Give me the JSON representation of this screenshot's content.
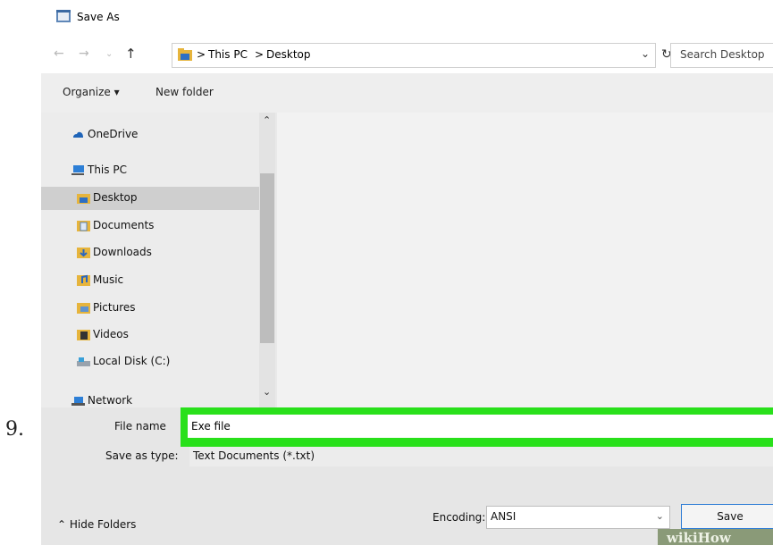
{
  "step_number": "9.",
  "window": {
    "title": "Save As"
  },
  "navigation": {
    "back_icon": "arrow-left-icon",
    "forward_icon": "arrow-right-icon",
    "recent_icon": "chevron-down-icon",
    "up_icon": "arrow-up-icon"
  },
  "address_bar": {
    "segments": [
      "This PC",
      "Desktop"
    ],
    "separator": ">"
  },
  "search": {
    "placeholder": "Search Desktop"
  },
  "toolbar": {
    "organize_label": "Organize ▾",
    "new_folder_label": "New folder"
  },
  "sidebar": {
    "items": [
      {
        "label": "OneDrive",
        "icon": "cloud-icon"
      },
      {
        "label": "This PC",
        "icon": "computer-icon"
      },
      {
        "label": "Desktop",
        "icon": "desktop-folder-icon",
        "selected": true
      },
      {
        "label": "Documents",
        "icon": "documents-icon"
      },
      {
        "label": "Downloads",
        "icon": "downloads-icon"
      },
      {
        "label": "Music",
        "icon": "music-icon"
      },
      {
        "label": "Pictures",
        "icon": "pictures-icon"
      },
      {
        "label": "Videos",
        "icon": "videos-icon"
      },
      {
        "label": "Local Disk (C:)",
        "icon": "disk-icon"
      },
      {
        "label": "Network",
        "icon": "network-icon"
      }
    ]
  },
  "form": {
    "file_name_label": "File name",
    "file_name_value": "Exe file",
    "save_as_type_label": "Save as type:",
    "save_as_type_value": "Text Documents (*.txt)",
    "highlight_color": "#29e01b"
  },
  "footer": {
    "hide_folders_label": "Hide Folders",
    "encoding_label": "Encoding:",
    "encoding_value": "ANSI",
    "save_label": "Save"
  },
  "watermark": "wikiHow",
  "colors": {
    "save_border": "#2a7ad5",
    "selected_bg": "#cfcfcf"
  }
}
